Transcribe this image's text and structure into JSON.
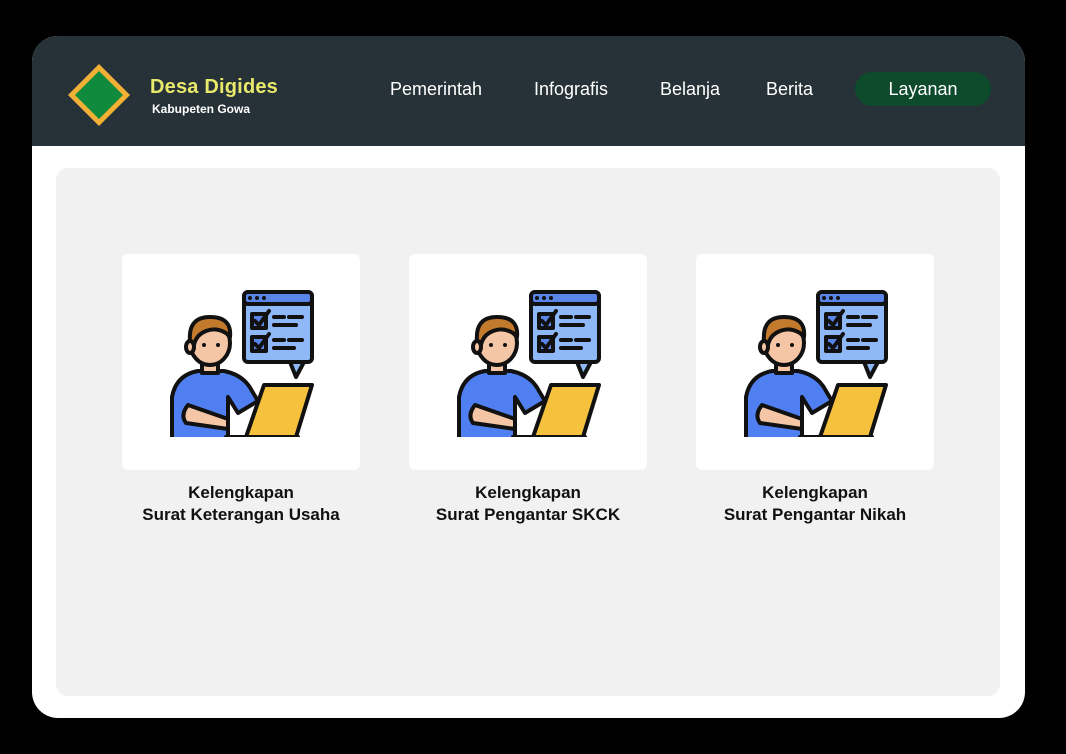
{
  "brand": {
    "name": "Desa Digides",
    "subtitle": "Kabupeten Gowa"
  },
  "nav": {
    "items": [
      "Pemerintah",
      "Infografis",
      "Belanja",
      "Berita"
    ],
    "cta_label": "Layanan"
  },
  "cards": [
    {
      "line1": "Kelengkapan",
      "line2": "Surat Keterangan Usaha",
      "icon": "person-laptop-checklist-icon"
    },
    {
      "line1": "Kelengkapan",
      "line2": "Surat Pengantar SKCK",
      "icon": "person-laptop-checklist-icon"
    },
    {
      "line1": "Kelengkapan",
      "line2": "Surat Pengantar Nikah",
      "icon": "person-laptop-checklist-icon"
    }
  ],
  "colors": {
    "navbar": "#263238",
    "brand_text": "#e8e86a",
    "cta": "#0e4a2c",
    "logo_outer": "#f2b134",
    "logo_inner": "#0f8a3c"
  }
}
